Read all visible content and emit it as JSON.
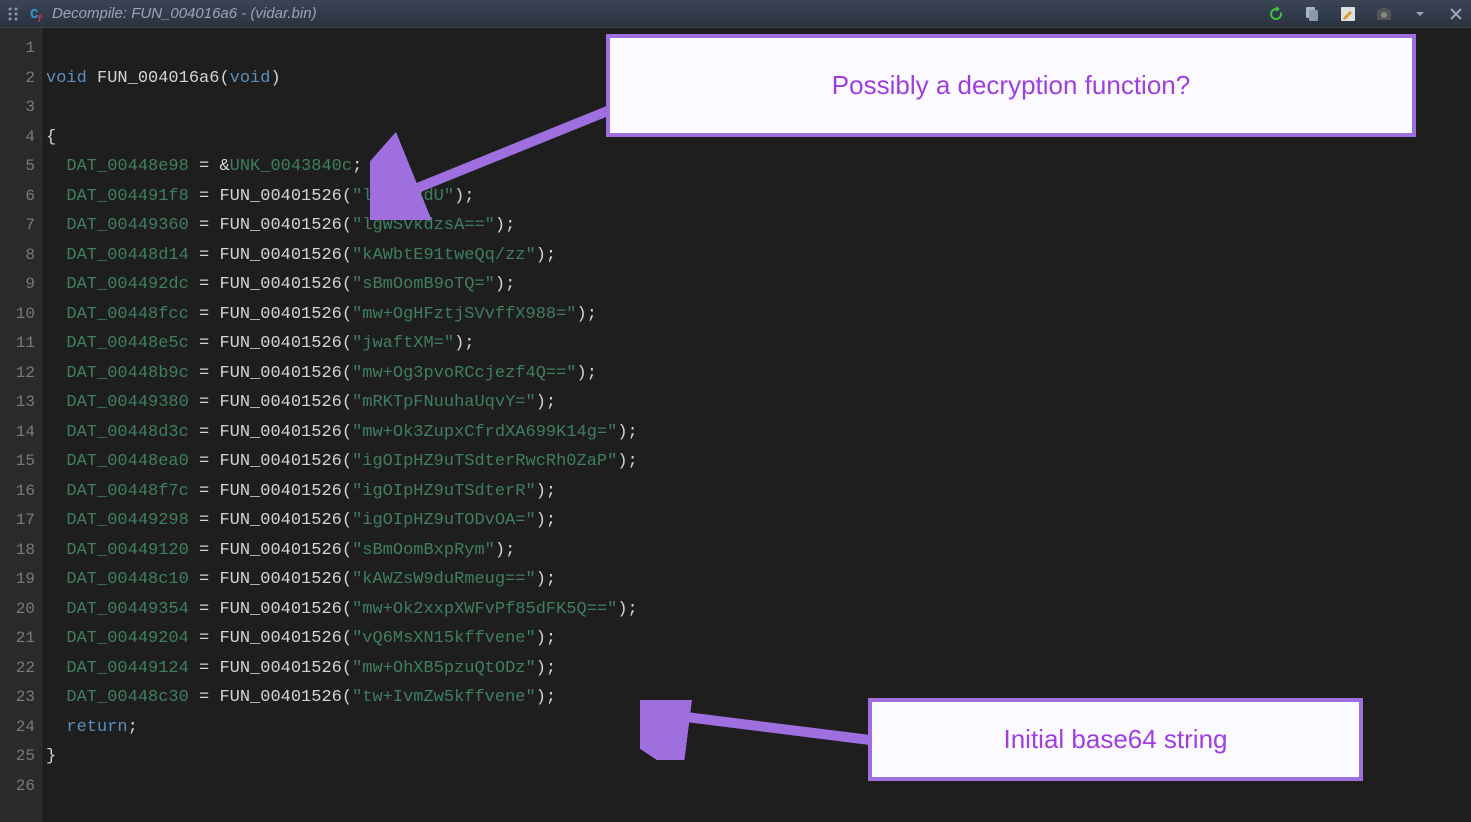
{
  "title": "Decompile: FUN_004016a6 -  (vidar.bin)",
  "callouts": {
    "callout1": "Possibly a decryption function?",
    "callout2": "Initial base64 string"
  },
  "lines": [
    {
      "n": 1,
      "raw": ""
    },
    {
      "n": 2,
      "sig": {
        "kw1": "void",
        "fn": "FUN_004016a6",
        "paren_open": "(",
        "kw2": "void",
        "paren_close": ")"
      }
    },
    {
      "n": 3,
      "raw": ""
    },
    {
      "n": 4,
      "raw": "{"
    },
    {
      "n": 5,
      "assign_unk": {
        "dat": "DAT_00448e98",
        "unk": "UNK_0043840c"
      }
    },
    {
      "n": 6,
      "assign_call": {
        "dat": "DAT_004491f8",
        "fn": "FUN_00401526",
        "str": "\"lCu26VdU\""
      }
    },
    {
      "n": 7,
      "assign_call": {
        "dat": "DAT_00449360",
        "fn": "FUN_00401526",
        "str": "\"lgWSvkdzsA==\""
      }
    },
    {
      "n": 8,
      "assign_call": {
        "dat": "DAT_00448d14",
        "fn": "FUN_00401526",
        "str": "\"kAWbtE91tweQq/zz\""
      }
    },
    {
      "n": 9,
      "assign_call": {
        "dat": "DAT_004492dc",
        "fn": "FUN_00401526",
        "str": "\"sBmOomB9oTQ=\""
      }
    },
    {
      "n": 10,
      "assign_call": {
        "dat": "DAT_00448fcc",
        "fn": "FUN_00401526",
        "str": "\"mw+OgHFztjSVvffX988=\""
      }
    },
    {
      "n": 11,
      "assign_call": {
        "dat": "DAT_00448e5c",
        "fn": "FUN_00401526",
        "str": "\"jwaftXM=\""
      }
    },
    {
      "n": 12,
      "assign_call": {
        "dat": "DAT_00448b9c",
        "fn": "FUN_00401526",
        "str": "\"mw+Og3pvoRCcjezf4Q==\""
      }
    },
    {
      "n": 13,
      "assign_call": {
        "dat": "DAT_00449380",
        "fn": "FUN_00401526",
        "str": "\"mRKTpFNuuhaUqvY=\""
      }
    },
    {
      "n": 14,
      "assign_call": {
        "dat": "DAT_00448d3c",
        "fn": "FUN_00401526",
        "str": "\"mw+Ok3ZupxCfrdXA699K14g=\""
      }
    },
    {
      "n": 15,
      "assign_call": {
        "dat": "DAT_00448ea0",
        "fn": "FUN_00401526",
        "str": "\"igOIpHZ9uTSdterRwcRh0ZaP\""
      }
    },
    {
      "n": 16,
      "assign_call": {
        "dat": "DAT_00448f7c",
        "fn": "FUN_00401526",
        "str": "\"igOIpHZ9uTSdterR\""
      }
    },
    {
      "n": 17,
      "assign_call": {
        "dat": "DAT_00449298",
        "fn": "FUN_00401526",
        "str": "\"igOIpHZ9uTODvOA=\""
      }
    },
    {
      "n": 18,
      "assign_call": {
        "dat": "DAT_00449120",
        "fn": "FUN_00401526",
        "str": "\"sBmOomBxpRym\""
      }
    },
    {
      "n": 19,
      "assign_call": {
        "dat": "DAT_00448c10",
        "fn": "FUN_00401526",
        "str": "\"kAWZsW9duRmeug==\""
      }
    },
    {
      "n": 20,
      "assign_call": {
        "dat": "DAT_00449354",
        "fn": "FUN_00401526",
        "str": "\"mw+Ok2xxpXWFvPf85dFK5Q==\""
      }
    },
    {
      "n": 21,
      "assign_call": {
        "dat": "DAT_00449204",
        "fn": "FUN_00401526",
        "str": "\"vQ6MsXN15kffvene\""
      }
    },
    {
      "n": 22,
      "assign_call": {
        "dat": "DAT_00449124",
        "fn": "FUN_00401526",
        "str": "\"mw+OhXB5pzuQtODz\""
      }
    },
    {
      "n": 23,
      "assign_call": {
        "dat": "DAT_00448c30",
        "fn": "FUN_00401526",
        "str": "\"tw+IvmZw5kffvene\""
      }
    },
    {
      "n": 24,
      "ret": "return"
    },
    {
      "n": 25,
      "raw": "}"
    },
    {
      "n": 26,
      "raw": ""
    }
  ]
}
